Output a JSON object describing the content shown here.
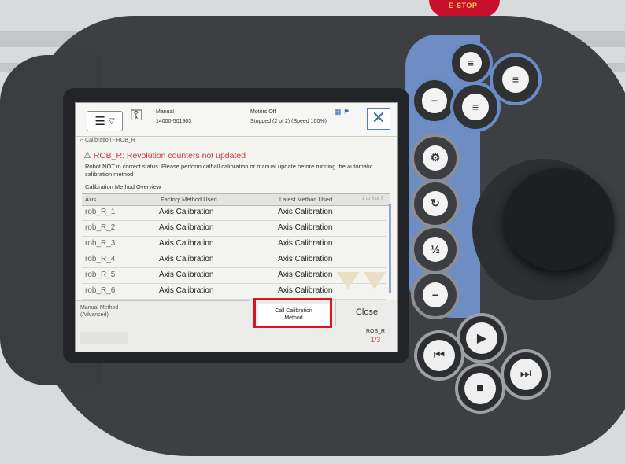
{
  "hardware": {
    "estop_label": "E-STOP"
  },
  "header": {
    "mode": "Manual",
    "controller_id": "14000-501903",
    "motors_state": "Motors Off",
    "run_state": "Stopped (2 of 2) (Speed 100%)"
  },
  "breadcrumb": "Calibration - ROB_R",
  "error": {
    "title": "ROB_R:  Revolution counters not updated",
    "message": "Robot NOT in correct status. Please perform calhall calibration or manual update before running the automatic calibration method"
  },
  "overview_title": "Calibration Method Overview",
  "table": {
    "columns": [
      "Axis",
      "Factory Method Used",
      "Latest Method Used"
    ],
    "page_info": "1 to 6 of 7",
    "rows": [
      {
        "axis": "rob_R_1",
        "factory": "Axis Calibration",
        "latest": "Axis Calibration"
      },
      {
        "axis": "rob_R_2",
        "factory": "Axis Calibration",
        "latest": "Axis Calibration"
      },
      {
        "axis": "rob_R_3",
        "factory": "Axis Calibration",
        "latest": "Axis Calibration"
      },
      {
        "axis": "rob_R_4",
        "factory": "Axis Calibration",
        "latest": "Axis Calibration"
      },
      {
        "axis": "rob_R_5",
        "factory": "Axis Calibration",
        "latest": "Axis Calibration"
      },
      {
        "axis": "rob_R_6",
        "factory": "Axis Calibration",
        "latest": "Axis Calibration"
      }
    ]
  },
  "footer": {
    "manual_method": "Manual Method",
    "manual_method_sub": "(Advanced)",
    "call_calibration_1": "Call Calibration",
    "call_calibration_2": "Method",
    "close_label": "Close",
    "task_name": "ROB_R",
    "task_fraction": "1/3"
  },
  "colors": {
    "error_text": "#c93b3b",
    "highlight": "#d91620",
    "blue_accent": "#6d8dc4"
  }
}
